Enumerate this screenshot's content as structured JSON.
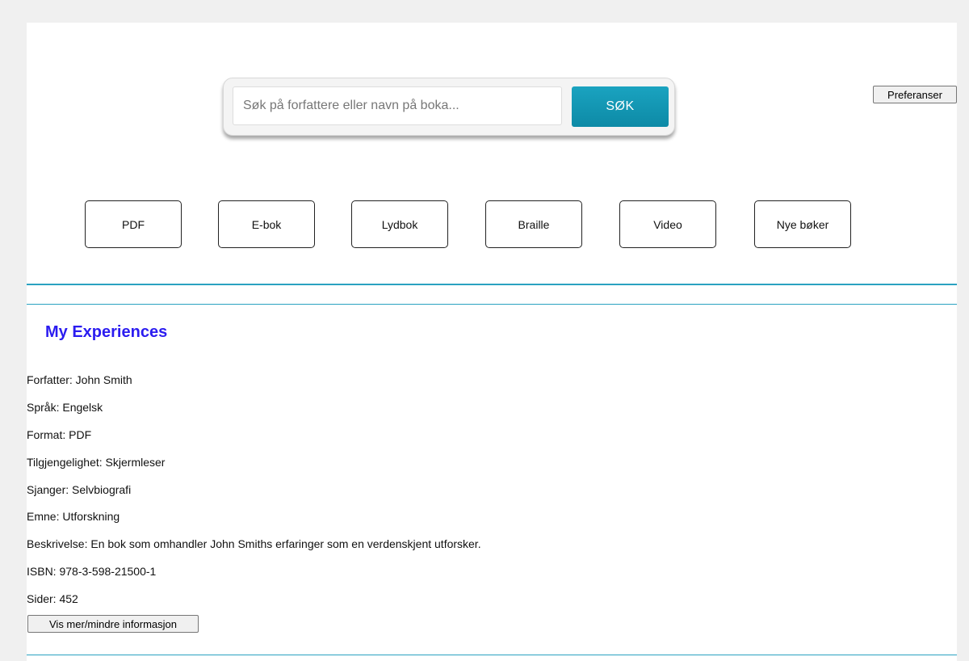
{
  "search": {
    "placeholder": "Søk på forfattere eller navn på boka...",
    "value": "",
    "button_label": "SØK"
  },
  "preferences_label": "Preferanser",
  "formats": [
    "PDF",
    "E-bok",
    "Lydbok",
    "Braille",
    "Video",
    "Nye bøker"
  ],
  "section_title": "My Experiences",
  "book": {
    "forfatter": "Forfatter: John Smith",
    "sprak": "Språk: Engelsk",
    "format": "Format: PDF",
    "tilgjengelighet": "Tilgjengelighet: Skjermleser",
    "sjanger": "Sjanger: Selvbiografi",
    "emne": "Emne: Utforskning",
    "beskrivelse": "Beskrivelse: En bok som omhandler John Smiths erfaringer som en verdenskjent utforsker.",
    "isbn": "ISBN: 978-3-598-21500-1",
    "sider": "Sider: 452"
  },
  "toggle_label": "Vis mer/mindre informasjon",
  "colors": {
    "accent": "#1aa3c0",
    "divider": "#2aa2c0",
    "title": "#2b1cf0"
  }
}
